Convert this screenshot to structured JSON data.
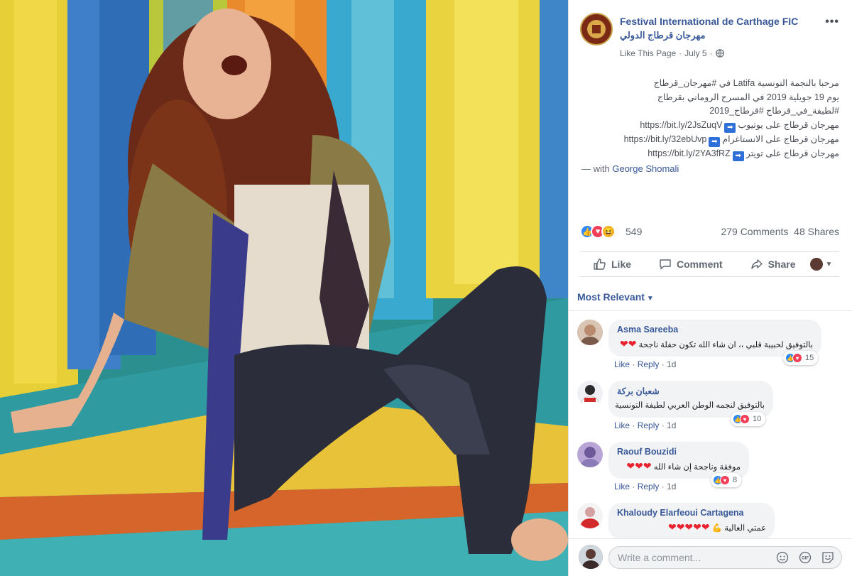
{
  "post": {
    "page_name": "Festival International de Carthage FIC",
    "page_name_ar": "مهرجان قرطاج الدولي",
    "like_page": "Like This Page",
    "date": "July 5",
    "text_lines": [
      "مرحبا بالنجمة التونسية Latifa في #مهرجان_قرطاج",
      "يوم 19 جويلية 2019 في المسرح الروماني بقرطاج",
      "#لطيفة_في_قرطاج #قرطاج_2019"
    ],
    "links": [
      {
        "label": "مهرجان قرطاج على يوتيوب",
        "url": "https://bit.ly/2JsZuqV"
      },
      {
        "label": "مهرجان قرطاج على الانستاغرام",
        "url": "https://bit.ly/32ebUvp"
      },
      {
        "label": "مهرجان قرطاج على تويتر",
        "url": "https://bit.ly/2YA3fRZ"
      }
    ],
    "with_prefix": "— with",
    "tagged_person": "George Shomali",
    "reactions_count": "549",
    "comments_count": "279 Comments",
    "shares_count": "48 Shares"
  },
  "actions": {
    "like": "Like",
    "comment": "Comment",
    "share": "Share"
  },
  "sort_label": "Most Relevant",
  "comments": [
    {
      "name": "Asma Sareeba",
      "text": "بالتوفيق لحبيبة قلبي ،، ان شاء الله تكون حفلة ناجحة",
      "hearts": "❤❤",
      "reactions": "15",
      "like": "Like",
      "reply": "Reply",
      "time": "1d"
    },
    {
      "name": "شعبان بركة",
      "text": "بالتوفيق لنجمه الوطن العربي لطيفة التونسية",
      "hearts": "",
      "reactions": "10",
      "like": "Like",
      "reply": "Reply",
      "time": "1d"
    },
    {
      "name": "Raouf Bouzidi",
      "text": "موفقة وناجحة إن شاء الله",
      "hearts": "❤❤❤",
      "reactions": "8",
      "like": "Like",
      "reply": "Reply",
      "time": "1d"
    },
    {
      "name": "Khaloudy Elarfeoui Cartagena",
      "text": "عمتي الغالية 💪",
      "hearts": "❤❤❤❤❤",
      "reactions": "",
      "like": "",
      "reply": "",
      "time": ""
    }
  ],
  "write_placeholder": "Write a comment...",
  "icons": [
    "globe-icon",
    "more-icon",
    "like-icon",
    "comment-icon",
    "share-icon",
    "emoji-icon",
    "gif-icon",
    "sticker-icon"
  ],
  "colors": {
    "link": "#385898",
    "like_blue": "#2d88ff",
    "love_red": "#f33e58",
    "haha_yellow": "#f7b125"
  }
}
